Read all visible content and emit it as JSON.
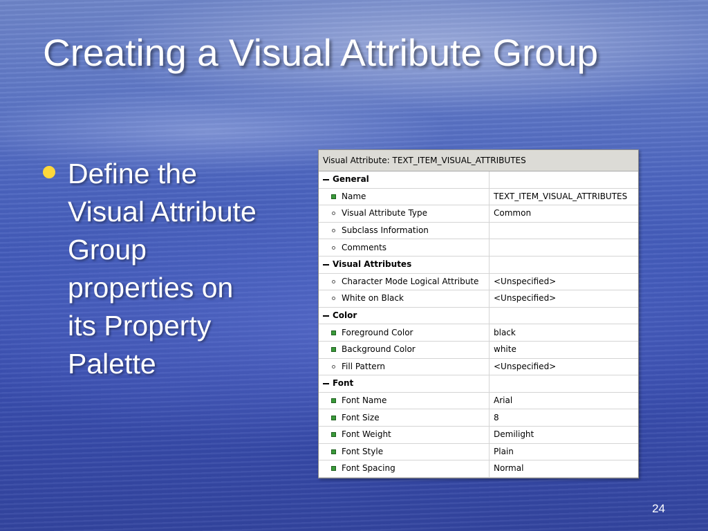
{
  "slide": {
    "title": "Creating a Visual Attribute Group",
    "bullet": "Define the Visual Attribute Group properties on its Property Palette",
    "page_number": "24",
    "bullet_color": "#ffd83a"
  },
  "palette": {
    "header": "Visual Attribute: TEXT_ITEM_VISUAL_ATTRIBUTES",
    "rows": [
      {
        "type": "group",
        "name": "General",
        "value": ""
      },
      {
        "type": "prop",
        "icon": "changed-square-icon",
        "name": "Name",
        "value": "TEXT_ITEM_VISUAL_ATTRIBUTES"
      },
      {
        "type": "prop",
        "icon": "default-circle-icon",
        "name": "Visual Attribute Type",
        "value": "Common"
      },
      {
        "type": "prop",
        "icon": "default-circle-icon",
        "name": "Subclass Information",
        "value": ""
      },
      {
        "type": "prop",
        "icon": "default-circle-icon",
        "name": "Comments",
        "value": ""
      },
      {
        "type": "group",
        "name": "Visual Attributes",
        "value": ""
      },
      {
        "type": "prop",
        "icon": "default-circle-icon",
        "name": "Character Mode Logical Attribute",
        "value": "<Unspecified>"
      },
      {
        "type": "prop",
        "icon": "default-circle-icon",
        "name": "White on Black",
        "value": "<Unspecified>"
      },
      {
        "type": "group",
        "name": "Color",
        "value": ""
      },
      {
        "type": "prop",
        "icon": "changed-square-icon",
        "name": "Foreground Color",
        "value": "black"
      },
      {
        "type": "prop",
        "icon": "changed-square-icon",
        "name": "Background Color",
        "value": "white"
      },
      {
        "type": "prop",
        "icon": "default-circle-icon",
        "name": "Fill Pattern",
        "value": "<Unspecified>"
      },
      {
        "type": "group",
        "name": "Font",
        "value": ""
      },
      {
        "type": "prop",
        "icon": "changed-square-icon",
        "name": "Font Name",
        "value": "Arial"
      },
      {
        "type": "prop",
        "icon": "changed-square-icon",
        "name": "Font Size",
        "value": "8"
      },
      {
        "type": "prop",
        "icon": "changed-square-icon",
        "name": "Font Weight",
        "value": "Demilight"
      },
      {
        "type": "prop",
        "icon": "changed-square-icon",
        "name": "Font Style",
        "value": "Plain"
      },
      {
        "type": "prop",
        "icon": "changed-square-icon",
        "name": "Font Spacing",
        "value": "Normal"
      }
    ]
  }
}
